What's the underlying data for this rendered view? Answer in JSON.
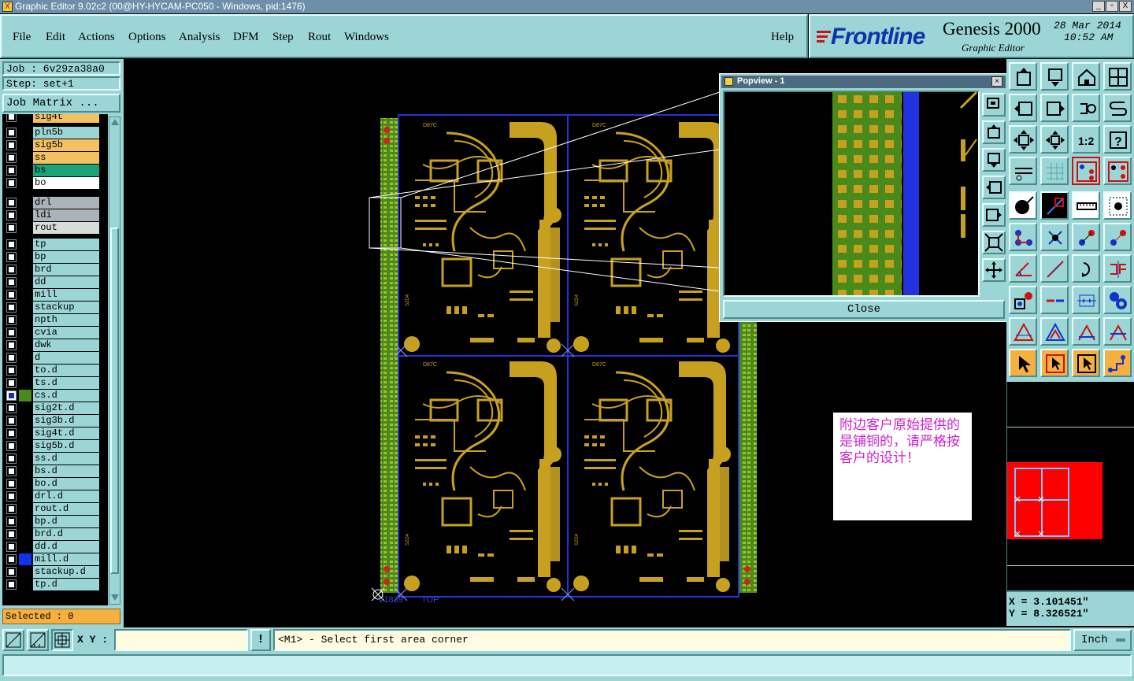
{
  "window": {
    "title": "Graphic Editor 9.02c2 (00@HY-HYCAM-PC050 - Windows, pid:1476)",
    "controls": [
      "_",
      "▫",
      "X"
    ]
  },
  "menu": {
    "items": [
      "File",
      "Edit",
      "Actions",
      "Options",
      "Analysis",
      "DFM",
      "Step",
      "Rout",
      "Windows"
    ],
    "help": "Help"
  },
  "brand": {
    "logo": "Frontline",
    "product": "Genesis 2000",
    "subtitle": "Graphic Editor",
    "date": "28 Mar 2014",
    "time": "10:52 AM"
  },
  "job": {
    "job_line": "Job : 6v29za38a0",
    "step_line": "Step: set+1",
    "matrix_button": "Job Matrix ..."
  },
  "layers": [
    {
      "name": "sig4t",
      "color": "#f5c060"
    },
    {
      "name": "pln5b",
      "color": "#9cd5d5"
    },
    {
      "name": "sig5b",
      "color": "#f5c060"
    },
    {
      "name": "ss",
      "color": "#f5c060"
    },
    {
      "name": "bs",
      "color": "#1aa37a"
    },
    {
      "name": "bo",
      "color": "#ffffff"
    },
    {
      "name": "drl",
      "color": "#a8b4b8"
    },
    {
      "name": "ldi",
      "color": "#a8b4b8"
    },
    {
      "name": "rout",
      "color": "#d8dcd8"
    },
    {
      "name": "tp",
      "color": "#9cd5d5"
    },
    {
      "name": "bp",
      "color": "#9cd5d5"
    },
    {
      "name": "brd",
      "color": "#9cd5d5"
    },
    {
      "name": "dd",
      "color": "#9cd5d5"
    },
    {
      "name": "mill",
      "color": "#9cd5d5"
    },
    {
      "name": "stackup",
      "color": "#9cd5d5"
    },
    {
      "name": "npth",
      "color": "#9cd5d5"
    },
    {
      "name": "cvia",
      "color": "#9cd5d5"
    },
    {
      "name": "dwk",
      "color": "#9cd5d5"
    },
    {
      "name": "d",
      "color": "#9cd5d5"
    },
    {
      "name": "to.d",
      "color": "#9cd5d5"
    },
    {
      "name": "ts.d",
      "color": "#9cd5d5"
    },
    {
      "name": "cs.d",
      "color": "#9cd5d5"
    },
    {
      "name": "sig2t.d",
      "color": "#9cd5d5"
    },
    {
      "name": "sig3b.d",
      "color": "#9cd5d5"
    },
    {
      "name": "sig4t.d",
      "color": "#9cd5d5"
    },
    {
      "name": "sig5b.d",
      "color": "#9cd5d5"
    },
    {
      "name": "ss.d",
      "color": "#9cd5d5"
    },
    {
      "name": "bs.d",
      "color": "#9cd5d5"
    },
    {
      "name": "bo.d",
      "color": "#9cd5d5"
    },
    {
      "name": "drl.d",
      "color": "#9cd5d5"
    },
    {
      "name": "rout.d",
      "color": "#9cd5d5"
    },
    {
      "name": "bp.d",
      "color": "#9cd5d5"
    },
    {
      "name": "brd.d",
      "color": "#9cd5d5"
    },
    {
      "name": "dd.d",
      "color": "#9cd5d5"
    },
    {
      "name": "mill.d",
      "color": "#9cd5d5"
    },
    {
      "name": "stackup.d",
      "color": "#9cd5d5"
    },
    {
      "name": "tp.d",
      "color": "#9cd5d5"
    }
  ],
  "selected": "Selected : 0",
  "popview": {
    "title": "Popview - 1",
    "close_label": "Close"
  },
  "note": {
    "text": "附边客户原始提供的是铺铜的，请严格按客户的设计！",
    "color": "#cc22cc"
  },
  "board_labels": {
    "corner": "V1839",
    "tag": "TOP"
  },
  "coords": {
    "x": "X = 3.101451\"",
    "y": "Y = 8.326521\""
  },
  "status": {
    "xy_label": "X Y :",
    "xy_value": "",
    "prompt": "<M1> - Select first area corner",
    "unit": "Inch"
  },
  "colors": {
    "panel": "#9cd5d5",
    "copper": "#c8a020",
    "board_green": "#4a8a1a",
    "outline_blue": "#2233dd",
    "minimap_red": "#ff0000"
  }
}
